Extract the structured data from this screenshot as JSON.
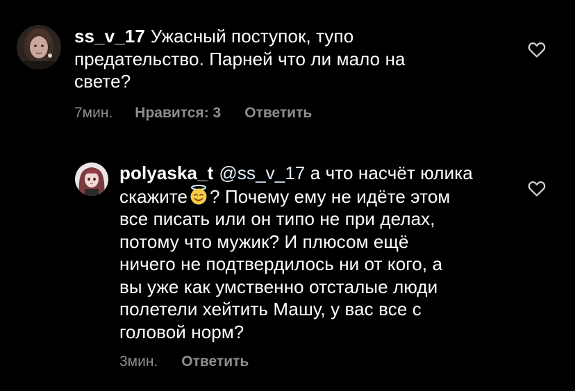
{
  "comments": [
    {
      "username": "ss_v_17",
      "text_lines": [
        "Ужасный поступок, тупо",
        "предательство. Парней что ли мало на",
        "свете?"
      ],
      "time": "7мин.",
      "likes_label": "Нравится: 3",
      "reply_label": "Ответить",
      "icon": "heart-outline-icon"
    },
    {
      "username": "polyaska_t",
      "mention": "@ss_v_17",
      "line1_rest": " а что насчёт юлика",
      "line2_before_emoji": "скажите",
      "emoji": "😇",
      "line2_after_emoji": "? Почему ему не идёте этом",
      "text_lines_rest": [
        "все писать или он типо не при делах,",
        "потому что мужик? И плюсом ещё",
        "ничего не подтвердилось ни от кого, а",
        "вы уже как умственно отсталые люди",
        "полетели хейтить Машу, у вас все с",
        "головой норм?"
      ],
      "time": "3мин.",
      "reply_label": "Ответить",
      "icon": "heart-outline-icon"
    }
  ],
  "colors": {
    "background": "#000000",
    "text": "#ffffff",
    "meta": "#8e8e8e"
  }
}
